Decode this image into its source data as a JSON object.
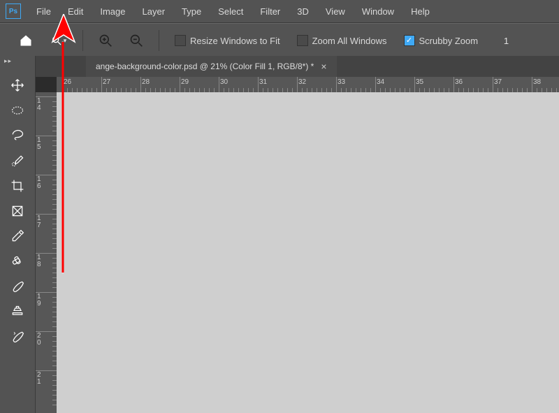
{
  "menubar": {
    "items": [
      "File",
      "Edit",
      "Image",
      "Layer",
      "Type",
      "Select",
      "Filter",
      "3D",
      "View",
      "Window",
      "Help"
    ]
  },
  "optionsBar": {
    "resize_label": "Resize Windows to Fit",
    "resize_checked": false,
    "zoom_all_label": "Zoom All Windows",
    "zoom_all_checked": false,
    "scrubby_label": "Scrubby Zoom",
    "scrubby_checked": true,
    "value_right": "1"
  },
  "document": {
    "tab_visible_text": "ange-background-color.psd @ 21% (Color Fill 1, RGB/8*) *",
    "full_name_hint": "change-background-color.psd",
    "zoom_percent": 21,
    "layer": "Color Fill 1",
    "mode": "RGB/8*",
    "modified": true
  },
  "rulers": {
    "horizontal": [
      26,
      27,
      28,
      29,
      30,
      31,
      32,
      33,
      34,
      35,
      36,
      37,
      38
    ],
    "vertical": [
      14,
      15,
      16,
      17,
      18,
      19,
      20,
      21
    ]
  },
  "tools": [
    {
      "id": "move"
    },
    {
      "id": "marquee-ellipse"
    },
    {
      "id": "lasso"
    },
    {
      "id": "quick-select"
    },
    {
      "id": "crop"
    },
    {
      "id": "frame"
    },
    {
      "id": "eyedropper"
    },
    {
      "id": "healing"
    },
    {
      "id": "brush"
    },
    {
      "id": "clone-stamp"
    },
    {
      "id": "history-brush"
    }
  ],
  "annotation": {
    "arrow_target": "File menu",
    "arrow_color": "#ff0000"
  }
}
